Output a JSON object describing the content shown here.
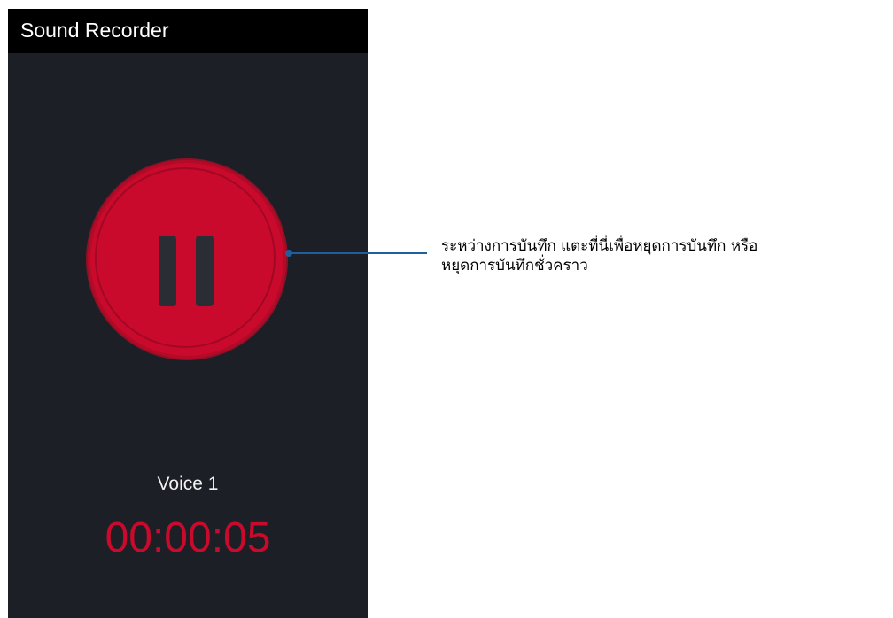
{
  "app": {
    "title": "Sound Recorder"
  },
  "recorder": {
    "button_icon": "pause-icon",
    "track_name": "Voice 1",
    "elapsed_time": "00:00:05"
  },
  "callout": {
    "lines": [
      "ระหว่างการบันทึก แตะที่นี่เพื่อหยุดการบันทึก หรือ",
      "หยุดการบันทึกชั่วคราว"
    ]
  },
  "colors": {
    "accent": "#c90a2c",
    "screen_background": "#1c1f26",
    "app_bar": "#000000",
    "callout_line": "#1f5fa0"
  }
}
